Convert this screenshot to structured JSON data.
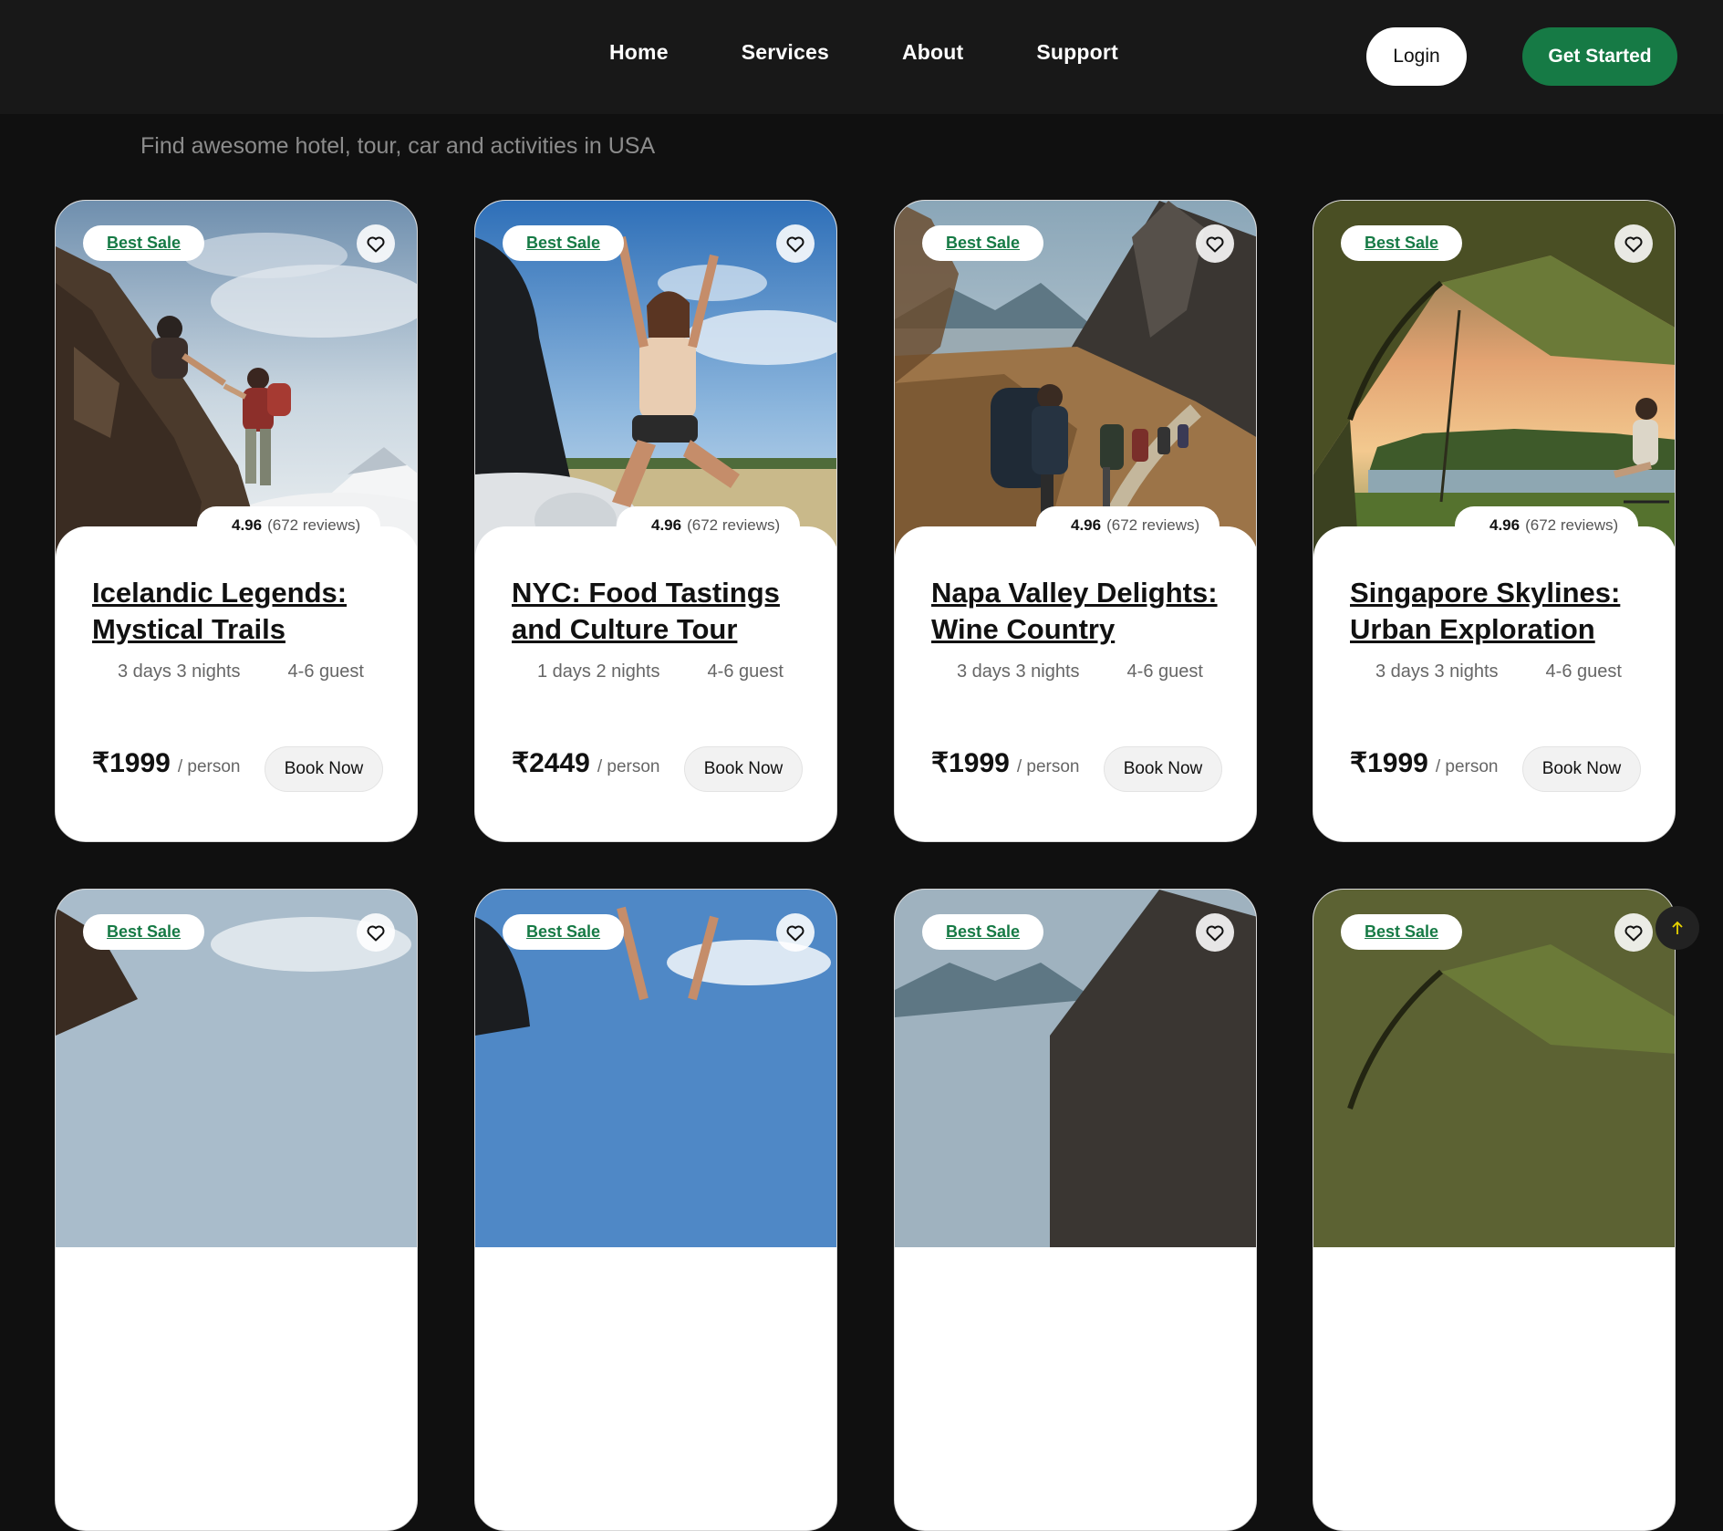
{
  "nav": {
    "links": [
      "Home",
      "Services",
      "About",
      "Support"
    ],
    "login_label": "Login",
    "get_started_label": "Get Started"
  },
  "section": {
    "subtitle": "Find awesome hotel, tour, car and activities in USA"
  },
  "cards": [
    {
      "badge": "Best Sale",
      "rating": "4.96",
      "reviews": "(672 reviews)",
      "title": "Icelandic Legends: Mystical Trails",
      "duration": "3 days 3 nights",
      "guests": "4-6 guest",
      "price": "₹1999",
      "price_unit": "/ person",
      "button": "Book Now",
      "image": "climbers-on-mountain-cliff"
    },
    {
      "badge": "Best Sale",
      "rating": "4.96",
      "reviews": "(672 reviews)",
      "title": "NYC: Food Tastings and Culture Tour",
      "duration": "1 days 2 nights",
      "guests": "4-6 guest",
      "price": "₹2449",
      "price_unit": "/ person",
      "button": "Book Now",
      "image": "woman-cheering-on-car"
    },
    {
      "badge": "Best Sale",
      "rating": "4.96",
      "reviews": "(672 reviews)",
      "title": "Napa Valley Delights: Wine Country",
      "duration": "3 days 3 nights",
      "guests": "4-6 guest",
      "price": "₹1999",
      "price_unit": "/ person",
      "button": "Book Now",
      "image": "hikers-on-mountain-trail"
    },
    {
      "badge": "Best Sale",
      "rating": "4.96",
      "reviews": "(672 reviews)",
      "title": "Singapore Skylines: Urban Exploration",
      "duration": "3 days 3 nights",
      "guests": "4-6 guest",
      "price": "₹1999",
      "price_unit": "/ person",
      "button": "Book Now",
      "image": "tent-lake-sunset"
    }
  ],
  "second_row": [
    {
      "badge": "Best Sale",
      "image": "climbers-on-mountain-cliff"
    },
    {
      "badge": "Best Sale",
      "image": "woman-cheering-on-car"
    },
    {
      "badge": "Best Sale",
      "image": "hikers-on-mountain-trail"
    },
    {
      "badge": "Best Sale",
      "image": "tent-lake-sunset"
    }
  ],
  "icons": {
    "heart": "heart-icon",
    "scroll_top": "arrow-up-icon"
  },
  "colors": {
    "brand_green": "#167a45",
    "background": "#101010",
    "navbar": "#181818",
    "scroll_arrow": "#e8d400"
  }
}
